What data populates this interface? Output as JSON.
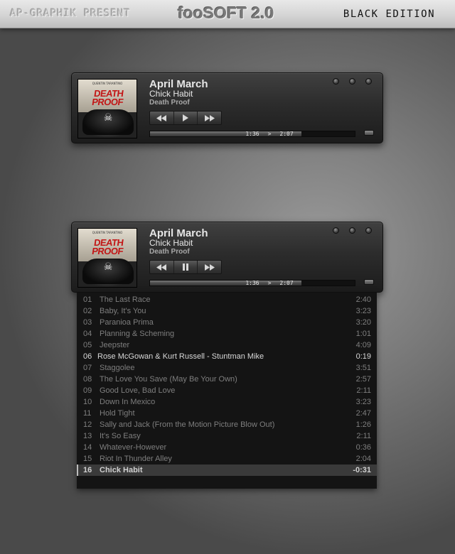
{
  "header": {
    "present": "AP-GRAPHIK PRESENT",
    "title": "fooSOFT 2.0",
    "edition": "BLACK EDITION"
  },
  "colors": {
    "accent": "#c21616",
    "panel": "#2c2c2c",
    "playlist_bg": "#141414"
  },
  "players": [
    {
      "cover_text": "DEATH PROOF",
      "title": "April March",
      "artist": "Chick Habit",
      "album": "Death Proof",
      "elapsed": "1:36",
      "separator": ">",
      "total": "2:07",
      "progress": 0.74,
      "play_state_icon": "play-icon"
    },
    {
      "cover_text": "DEATH PROOF",
      "title": "April March",
      "artist": "Chick Habit",
      "album": "Death Proof",
      "elapsed": "1:36",
      "separator": ">",
      "total": "2:07",
      "progress": 0.74,
      "play_state_icon": "pause-icon"
    }
  ],
  "playlist": [
    {
      "num": "01",
      "title": "The Last Race",
      "dur": "2:40"
    },
    {
      "num": "02",
      "title": "Baby, It's You",
      "dur": "3:23"
    },
    {
      "num": "03",
      "title": "Paranioa Prima",
      "dur": "3:20"
    },
    {
      "num": "04",
      "title": "Planning & Scheming",
      "dur": "1:01"
    },
    {
      "num": "05",
      "title": "Jeepster",
      "dur": "4:09"
    },
    {
      "num": "06",
      "title": "Rose McGowan & Kurt Russell - Stuntman Mike",
      "dur": "0:19"
    },
    {
      "num": "07",
      "title": "Staggolee",
      "dur": "3:51"
    },
    {
      "num": "08",
      "title": "The Love You Save (May Be Your Own)",
      "dur": "2:57"
    },
    {
      "num": "09",
      "title": "Good Love, Bad Love",
      "dur": "2:11"
    },
    {
      "num": "10",
      "title": "Down In Mexico",
      "dur": "3:23"
    },
    {
      "num": "11",
      "title": "Hold Tight",
      "dur": "2:47"
    },
    {
      "num": "12",
      "title": "Sally and Jack (From the Motion Picture Blow Out)",
      "dur": "1:26"
    },
    {
      "num": "13",
      "title": "It's So Easy",
      "dur": "2:11"
    },
    {
      "num": "14",
      "title": "Whatever-However",
      "dur": "0:36"
    },
    {
      "num": "15",
      "title": "Riot In Thunder Alley",
      "dur": "2:04"
    },
    {
      "num": "16",
      "title": "Chick Habit",
      "dur": "-0:31"
    }
  ]
}
